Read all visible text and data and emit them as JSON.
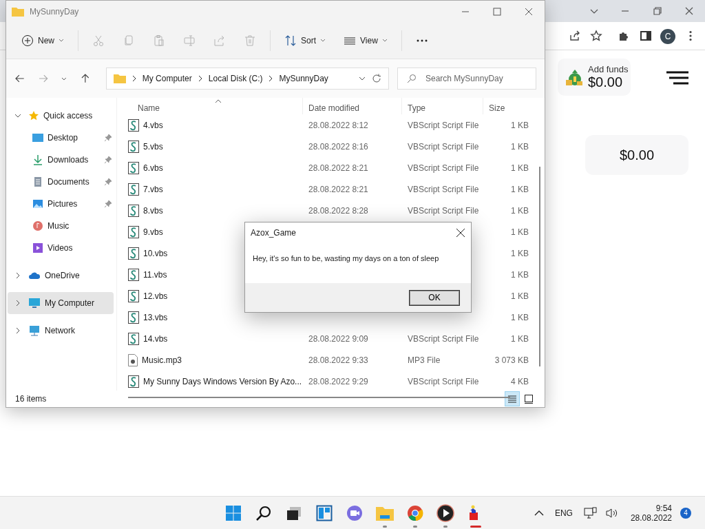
{
  "browser": {
    "avatar": "C",
    "wallet": {
      "label": "Add funds",
      "amount": "$0.00"
    },
    "balance": "$0.00"
  },
  "explorer": {
    "title": "MySunnyDay",
    "toolbar": [
      {
        "kind": "new",
        "label": "New",
        "disabled": false
      },
      {
        "kind": "cut",
        "disabled": true
      },
      {
        "kind": "copy",
        "disabled": true
      },
      {
        "kind": "paste",
        "disabled": true
      },
      {
        "kind": "rename",
        "disabled": true
      },
      {
        "kind": "share",
        "disabled": true
      },
      {
        "kind": "delete",
        "disabled": true
      },
      {
        "kind": "sort",
        "label": "Sort",
        "disabled": false
      },
      {
        "kind": "view",
        "label": "View",
        "disabled": false
      },
      {
        "kind": "more",
        "disabled": false
      }
    ],
    "breadcrumbs": [
      "My Computer",
      "Local Disk (C:)",
      "MySunnyDay"
    ],
    "search": {
      "placeholder": "Search MySunnyDay"
    },
    "sidebar": [
      {
        "label": "Quick access",
        "kind": "star",
        "expanded": true,
        "selected": false,
        "children": [
          {
            "label": "Desktop",
            "kind": "desktop",
            "pinned": true
          },
          {
            "label": "Downloads",
            "kind": "download",
            "pinned": true
          },
          {
            "label": "Documents",
            "kind": "document",
            "pinned": true
          },
          {
            "label": "Pictures",
            "kind": "picture",
            "pinned": true
          },
          {
            "label": "Music",
            "kind": "music",
            "pinned": false
          },
          {
            "label": "Videos",
            "kind": "video",
            "pinned": false
          }
        ]
      },
      {
        "label": "OneDrive",
        "kind": "cloud",
        "expanded": false,
        "selected": false
      },
      {
        "label": "My Computer",
        "kind": "computer",
        "expanded": false,
        "selected": true
      },
      {
        "label": "Network",
        "kind": "network",
        "expanded": false,
        "selected": false
      }
    ],
    "columns": [
      "Name",
      "Date modified",
      "Type",
      "Size"
    ],
    "files": [
      {
        "name": "4.vbs",
        "kind": "vbs",
        "date": "28.08.2022 8:12",
        "type": "VBScript Script File",
        "size": "1 KB"
      },
      {
        "name": "5.vbs",
        "kind": "vbs",
        "date": "28.08.2022 8:16",
        "type": "VBScript Script File",
        "size": "1 KB"
      },
      {
        "name": "6.vbs",
        "kind": "vbs",
        "date": "28.08.2022 8:21",
        "type": "VBScript Script File",
        "size": "1 KB"
      },
      {
        "name": "7.vbs",
        "kind": "vbs",
        "date": "28.08.2022 8:21",
        "type": "VBScript Script File",
        "size": "1 KB"
      },
      {
        "name": "8.vbs",
        "kind": "vbs",
        "date": "28.08.2022 8:28",
        "type": "VBScript Script File",
        "size": "1 KB"
      },
      {
        "name": "9.vbs",
        "kind": "vbs",
        "size": "1 KB"
      },
      {
        "name": "10.vbs",
        "kind": "vbs",
        "size": "1 KB"
      },
      {
        "name": "11.vbs",
        "kind": "vbs",
        "size": "1 KB"
      },
      {
        "name": "12.vbs",
        "kind": "vbs",
        "size": "1 KB"
      },
      {
        "name": "13.vbs",
        "kind": "vbs",
        "size": "1 KB"
      },
      {
        "name": "14.vbs",
        "kind": "vbs",
        "date": "28.08.2022 9:09",
        "type": "VBScript Script File",
        "size": "1 KB"
      },
      {
        "name": "Music.mp3",
        "kind": "mp3",
        "date": "28.08.2022 9:33",
        "type": "MP3 File",
        "size": "3 073 KB"
      },
      {
        "name": "My Sunny Days Windows Version By Azo...",
        "kind": "vbs",
        "date": "28.08.2022 9:29",
        "type": "VBScript Script File",
        "size": "4 KB"
      }
    ],
    "status": "16 items",
    "views": [
      {
        "kind": "details",
        "selected": true
      },
      {
        "kind": "tiles",
        "selected": false
      }
    ]
  },
  "dialog": {
    "title": "Azox_Game",
    "message": "Hey, it's so fun to be, wasting my days on a ton of sleep",
    "button": "OK"
  },
  "taskbar": {
    "apps": [
      {
        "kind": "start",
        "running": false,
        "selected": false
      },
      {
        "kind": "search",
        "running": false,
        "selected": false
      },
      {
        "kind": "taskview",
        "running": false,
        "selected": false
      },
      {
        "kind": "widgets",
        "running": false,
        "selected": false
      },
      {
        "kind": "chat",
        "running": false,
        "selected": false
      },
      {
        "kind": "explorer",
        "running": true,
        "selected": false
      },
      {
        "kind": "chrome",
        "running": true,
        "selected": false
      },
      {
        "kind": "player",
        "running": true,
        "selected": false
      },
      {
        "kind": "game",
        "running": true,
        "selected": true
      }
    ],
    "language": "ENG",
    "time": "9:54",
    "date": "28.08.2022",
    "notifications": "4"
  }
}
